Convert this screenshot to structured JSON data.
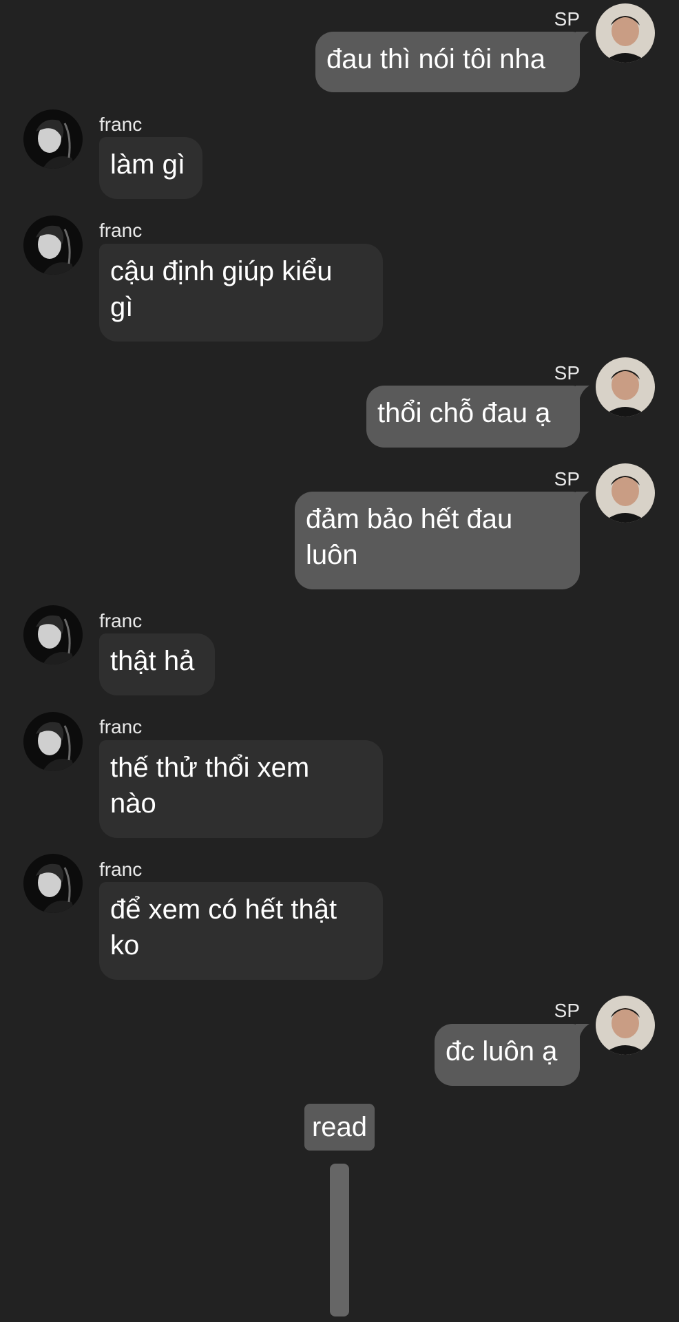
{
  "colors": {
    "background": "#222222",
    "incoming_bubble": "#2f2f2f",
    "outgoing_bubble": "#5a5a5a",
    "text": "#ffffff"
  },
  "messages": [
    {
      "sender": "SP",
      "direction": "outgoing",
      "text": "đau thì nói tôi nha"
    },
    {
      "sender": "franc",
      "direction": "incoming",
      "text": "làm gì"
    },
    {
      "sender": "franc",
      "direction": "incoming",
      "text": "cậu định giúp kiểu\ngì"
    },
    {
      "sender": "SP",
      "direction": "outgoing",
      "text": "thổi chỗ đau ạ"
    },
    {
      "sender": "SP",
      "direction": "outgoing",
      "text": "đảm bảo hết đau\nluôn"
    },
    {
      "sender": "franc",
      "direction": "incoming",
      "text": "thật hả"
    },
    {
      "sender": "franc",
      "direction": "incoming",
      "text": "thế thử thổi xem\nnào"
    },
    {
      "sender": "franc",
      "direction": "incoming",
      "text": "để xem có hết thật\nko"
    },
    {
      "sender": "SP",
      "direction": "outgoing",
      "text": "đc luôn ạ"
    }
  ],
  "read_status": "read"
}
